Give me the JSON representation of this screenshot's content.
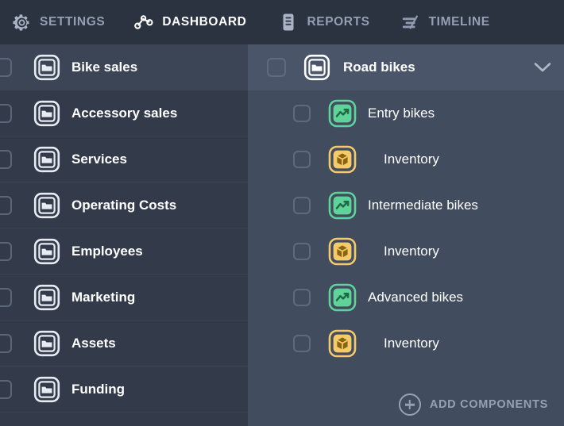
{
  "nav": {
    "tabs": [
      {
        "id": "settings",
        "label": "SETTINGS",
        "icon": "gear-icon",
        "active": false
      },
      {
        "id": "dashboard",
        "label": "DASHBOARD",
        "icon": "nodes-icon",
        "active": true
      },
      {
        "id": "reports",
        "label": "REPORTS",
        "icon": "document-icon",
        "active": false
      },
      {
        "id": "timeline",
        "label": "TIMELINE",
        "icon": "timeline-icon",
        "active": false
      }
    ]
  },
  "left_panel": {
    "items": [
      {
        "label": "Bike sales",
        "icon": "folder-icon",
        "checked": false,
        "highlighted": true
      },
      {
        "label": "Accessory sales",
        "icon": "folder-icon",
        "checked": false,
        "highlighted": false
      },
      {
        "label": "Services",
        "icon": "folder-icon",
        "checked": false,
        "highlighted": false
      },
      {
        "label": "Operating Costs",
        "icon": "folder-icon",
        "checked": false,
        "highlighted": false
      },
      {
        "label": "Employees",
        "icon": "folder-icon",
        "checked": false,
        "highlighted": false
      },
      {
        "label": "Marketing",
        "icon": "folder-icon",
        "checked": false,
        "highlighted": false
      },
      {
        "label": "Assets",
        "icon": "folder-icon",
        "checked": false,
        "highlighted": false
      },
      {
        "label": "Funding",
        "icon": "folder-icon",
        "checked": false,
        "highlighted": false
      }
    ]
  },
  "right_panel": {
    "header": {
      "label": "Road bikes",
      "icon": "folder-icon",
      "expand_icon": "chevron-down-icon",
      "checked": false,
      "expanded": true
    },
    "children": [
      {
        "label": "Entry bikes",
        "icon": "chart-trend-icon",
        "kind": "component",
        "checked": false
      },
      {
        "label": "Inventory",
        "icon": "cube-icon",
        "kind": "sub",
        "checked": false
      },
      {
        "label": "Intermediate bikes",
        "icon": "chart-trend-icon",
        "kind": "component",
        "checked": false
      },
      {
        "label": "Inventory",
        "icon": "cube-icon",
        "kind": "sub",
        "checked": false
      },
      {
        "label": "Advanced bikes",
        "icon": "chart-trend-icon",
        "kind": "component",
        "checked": false
      },
      {
        "label": "Inventory",
        "icon": "cube-icon",
        "kind": "sub",
        "checked": false
      }
    ],
    "add_components": {
      "label": "ADD COMPONENTS",
      "icon": "plus-circle-icon"
    }
  },
  "colors": {
    "topbar_bg": "#2b3240",
    "left_panel_bg": "#333b4b",
    "left_panel_highlight": "#3c4556",
    "right_panel_bg": "#414c5f",
    "right_header_bg": "#4a556a",
    "nav_inactive": "#93a0b4",
    "nav_active": "#ffffff",
    "green_accent": "#5fd39a",
    "orange_accent": "#f5ca6b",
    "muted_text": "#94a0b3"
  }
}
